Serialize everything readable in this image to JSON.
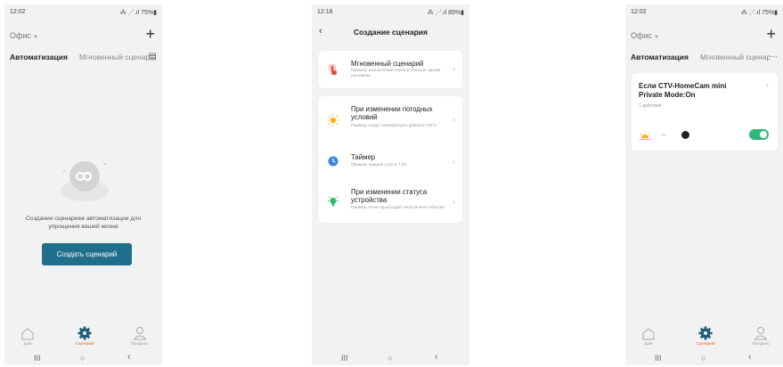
{
  "screen1": {
    "status": {
      "time": "12:02",
      "icons": "⁂ ⋰.ıl 75%▮"
    },
    "workspace": {
      "name": "Офис",
      "caret": "▼",
      "add_icon": "+"
    },
    "tabs": {
      "automation": "Автоматизация",
      "instant": "Мгновенный сценарий",
      "menu_icon": "▤"
    },
    "empty": {
      "text": "Создание сценариев автоматизации для упрощения вашей жизни"
    },
    "create_button": "Создать сценарий"
  },
  "screen2": {
    "status": {
      "time": "12:18",
      "icons": "⁂ ⋰.ıl 85%▮"
    },
    "header": {
      "back": "‹",
      "title": "Создание сценария"
    },
    "options": [
      {
        "title": "Мгновенный сценарий",
        "desc": "Пример: выключение света в спальне одним касанием."
      },
      {
        "title": "При изменении погодных условий",
        "desc": "Пример: когда температура превысит 28°C."
      },
      {
        "title": "Таймер",
        "desc": "Пример: каждое утро в 7:00."
      },
      {
        "title": "При изменении статуса устройства",
        "desc": "Пример: если происходит непатичное событие."
      }
    ]
  },
  "screen3": {
    "status": {
      "time": "12:02",
      "icons": "⁂ ⋰.ıl 75%▮"
    },
    "workspace": {
      "name": "Офис",
      "caret": "▼",
      "add_icon": "+"
    },
    "tabs": {
      "automation": "Автоматизация",
      "instant": "Мгновенный сценарий",
      "more_icon": "···"
    },
    "card": {
      "title": "Если CTV-HomeCam mini Private Mode:On",
      "actions": "1 действия",
      "arrow": "↔",
      "enabled": true
    }
  },
  "nav": {
    "home": "Дом",
    "scenes": "Сценарий",
    "profile": "Профиль"
  },
  "sysnav": {
    "recent": "III",
    "home": "○",
    "back": "‹"
  },
  "colors": {
    "accent": "#1f6e8c",
    "active_tab": "#e66a1f",
    "toggle_on": "#2db87a",
    "background": "#f2f2f2"
  }
}
